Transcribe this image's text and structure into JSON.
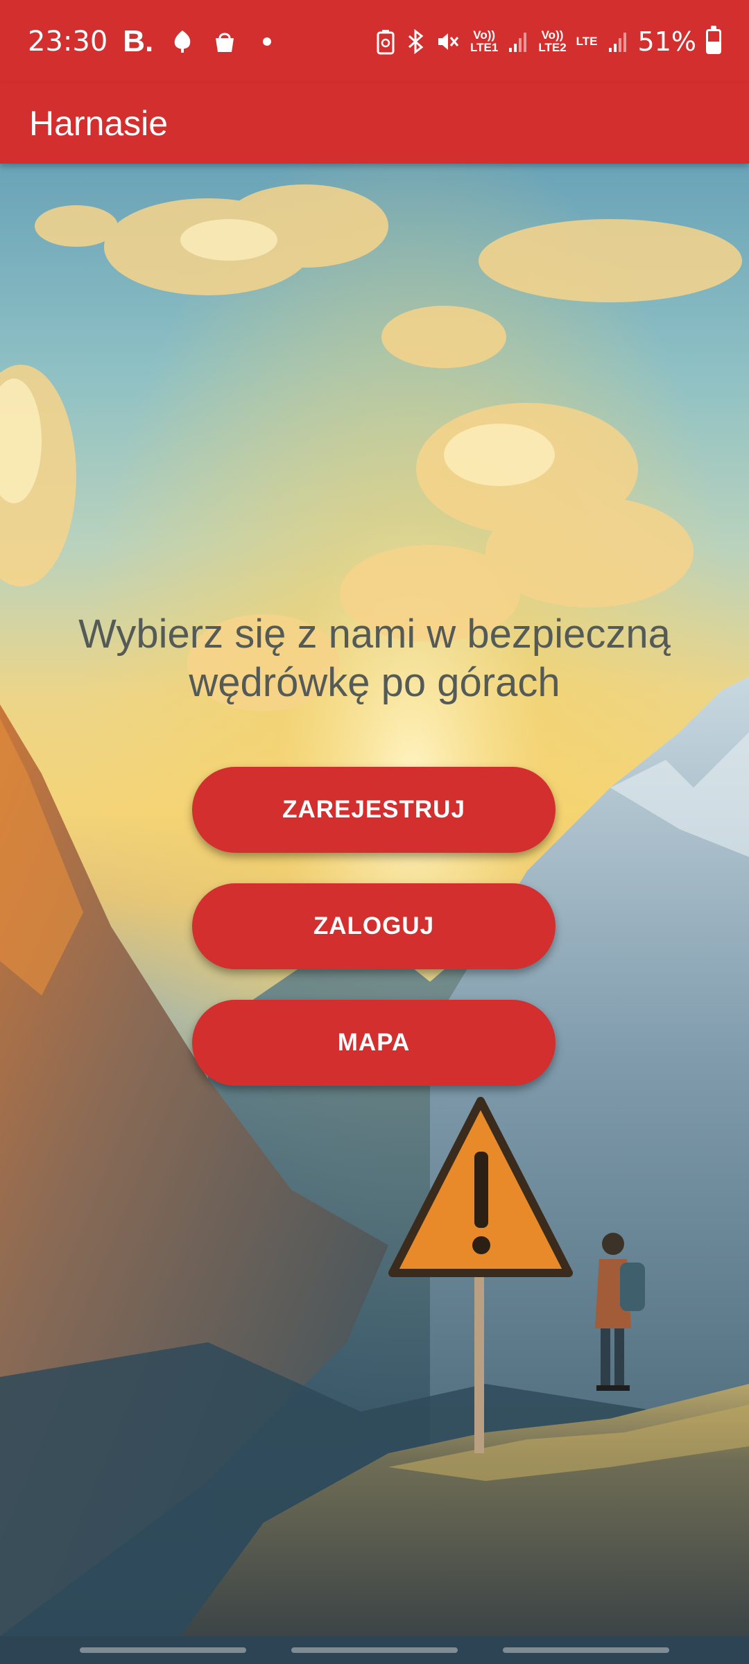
{
  "status_bar": {
    "time": "23:30",
    "left_letter": "B.",
    "sim1_label": "Vo))\nLTE1",
    "sim2_label": "Vo))\nLTE2",
    "data_label": "LTE",
    "battery_percent": "51%",
    "battery_level": 0.51
  },
  "app_bar": {
    "title": "Harnasie"
  },
  "main": {
    "headline": "Wybierz się z nami w bezpieczną wędrówkę po górach",
    "register_label": "ZAREJESTRUJ",
    "login_label": "ZALOGUJ",
    "map_label": "MAPA"
  },
  "colors": {
    "accent": "#d32f2f",
    "headline_text": "#545a58"
  }
}
